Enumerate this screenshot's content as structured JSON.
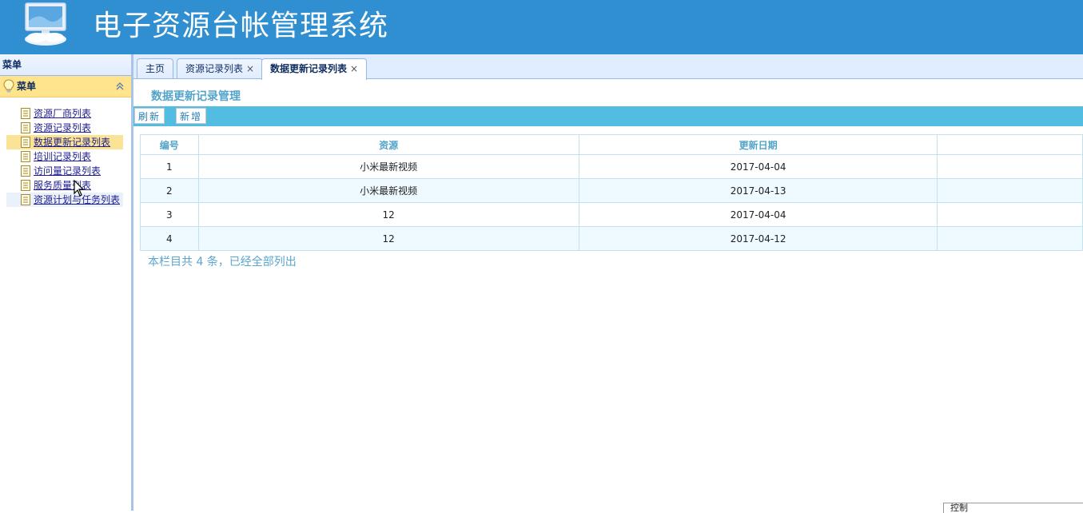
{
  "app": {
    "title": "电子资源台帐管理系统",
    "icon": "computer-monitor-icon"
  },
  "sidebar": {
    "top_label": "菜单",
    "panel_title": "菜单",
    "panel_icon": "lightbulb-icon",
    "items": [
      {
        "label": "资源厂商列表",
        "icon": "document-icon",
        "state": "normal"
      },
      {
        "label": "资源记录列表",
        "icon": "document-icon",
        "state": "normal"
      },
      {
        "label": "数据更新记录列表",
        "icon": "document-icon",
        "state": "active"
      },
      {
        "label": "培训记录列表",
        "icon": "document-icon",
        "state": "normal"
      },
      {
        "label": "访问量记录列表",
        "icon": "document-icon",
        "state": "normal"
      },
      {
        "label": "服务质量列表",
        "icon": "document-icon",
        "state": "normal"
      },
      {
        "label": "资源计划与任务列表",
        "icon": "document-icon",
        "state": "hover"
      }
    ]
  },
  "tabs": [
    {
      "label": "主页",
      "closable": false,
      "active": false
    },
    {
      "label": "资源记录列表",
      "closable": true,
      "active": false
    },
    {
      "label": "数据更新记录列表",
      "closable": true,
      "active": true
    }
  ],
  "tab_close_glyph": "×",
  "content": {
    "section_title": "数据更新记录管理",
    "toolbar": {
      "refresh_label": "刷新",
      "add_label": "新增"
    },
    "table": {
      "headers": [
        "编号",
        "资源",
        "更新日期",
        ""
      ],
      "rows": [
        [
          "1",
          "小米最新视频",
          "2017-04-04",
          ""
        ],
        [
          "2",
          "小米最新视频",
          "2017-04-13",
          ""
        ],
        [
          "3",
          "12",
          "2017-04-04",
          ""
        ],
        [
          "4",
          "12",
          "2017-04-12",
          ""
        ]
      ]
    },
    "summary": "本栏目共 4 条，已经全部列出"
  },
  "status_box_text": "控制",
  "colors": {
    "header_bg": "#2f8fd0",
    "toolbar_bg": "#52bde0",
    "accent_text": "#52a4c9",
    "active_menu_bg": "#fbe396"
  }
}
